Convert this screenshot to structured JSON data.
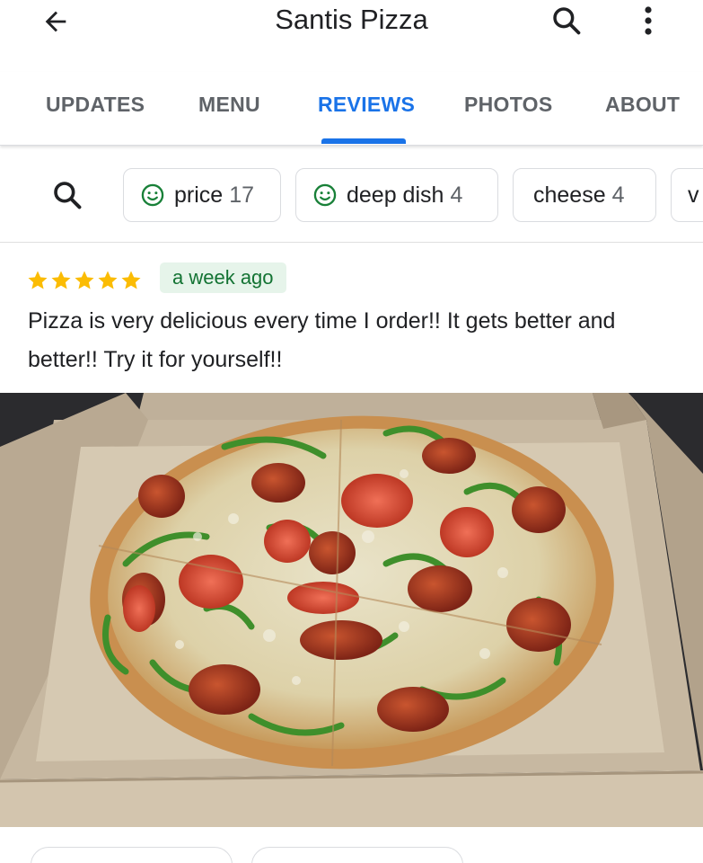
{
  "header": {
    "title": "Santis Pizza",
    "back_icon": "arrow-back-icon",
    "search_icon": "search-icon",
    "more_icon": "more-vert-icon"
  },
  "tabs": [
    {
      "label": "UPDATES",
      "active": false
    },
    {
      "label": "MENU",
      "active": false
    },
    {
      "label": "REVIEWS",
      "active": true
    },
    {
      "label": "PHOTOS",
      "active": false
    },
    {
      "label": "ABOUT",
      "active": false
    }
  ],
  "filters": {
    "search_icon": "search-icon",
    "chips": [
      {
        "label": "price",
        "count": "17",
        "icon": "smile-icon"
      },
      {
        "label": "deep dish",
        "count": "4",
        "icon": "smile-icon"
      },
      {
        "label": "cheese",
        "count": "4",
        "icon": ""
      },
      {
        "label": "v",
        "count": "",
        "icon": ""
      }
    ]
  },
  "review": {
    "rating": 5,
    "time": "a week ago",
    "text": "Pizza is very delicious every time I order!! It gets better and better!! Try it for yourself!!",
    "photo_icon": "pizza-photo"
  },
  "colors": {
    "accent": "#1a73e8",
    "star": "#fbbc04",
    "badge_bg": "#e6f4ea",
    "badge_text": "#137333",
    "smile": "#188038"
  }
}
